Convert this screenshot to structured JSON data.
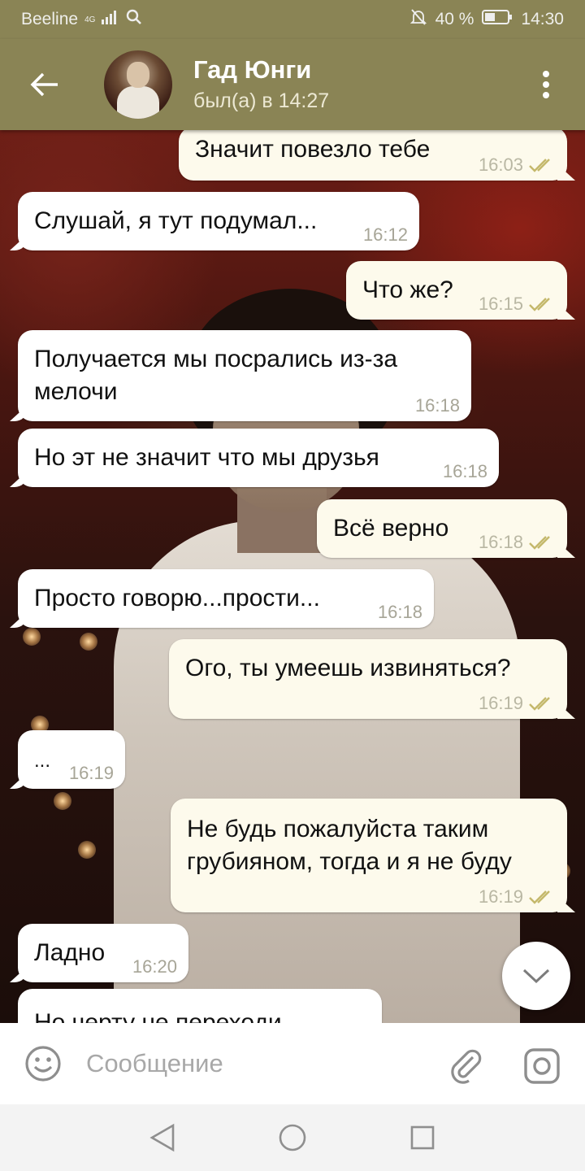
{
  "status_bar": {
    "carrier": "Beeline",
    "network": "4G",
    "battery": "40 %",
    "time": "14:30"
  },
  "header": {
    "name": "Гад Юнги",
    "last_seen": "был(а) в 14:27"
  },
  "messages": [
    {
      "dir": "out",
      "text": "Значит повезло тебе",
      "time": "16:03",
      "read": true
    },
    {
      "dir": "in",
      "text": "Слушай, я тут подумал...",
      "time": "16:12"
    },
    {
      "dir": "out",
      "text": "Что же?",
      "time": "16:15",
      "read": true
    },
    {
      "dir": "in",
      "text": "Получается мы посрались из-за мелочи",
      "time": "16:18"
    },
    {
      "dir": "in",
      "text": "Но эт не значит что мы друзья",
      "time": "16:18"
    },
    {
      "dir": "out",
      "text": "Всё верно",
      "time": "16:18",
      "read": true
    },
    {
      "dir": "in",
      "text": "Просто говорю...прости...",
      "time": "16:18"
    },
    {
      "dir": "out",
      "text": "Ого, ты умеешь извиняться?",
      "time": "16:19",
      "read": true
    },
    {
      "dir": "in",
      "text": "...",
      "time": "16:19"
    },
    {
      "dir": "out",
      "text": "Не будь пожалуйста таким грубияном, тогда и я не буду",
      "time": "16:19",
      "read": true
    },
    {
      "dir": "in",
      "text": "Ладно",
      "time": "16:20"
    },
    {
      "dir": "in",
      "text": "Но черту не переходи",
      "time": ""
    }
  ],
  "input": {
    "placeholder": "Сообщение"
  },
  "colors": {
    "header": "#8a8455",
    "incoming_bubble": "#ffffff",
    "outgoing_bubble": "#fdfaec",
    "read_check": "#c4b86b"
  }
}
